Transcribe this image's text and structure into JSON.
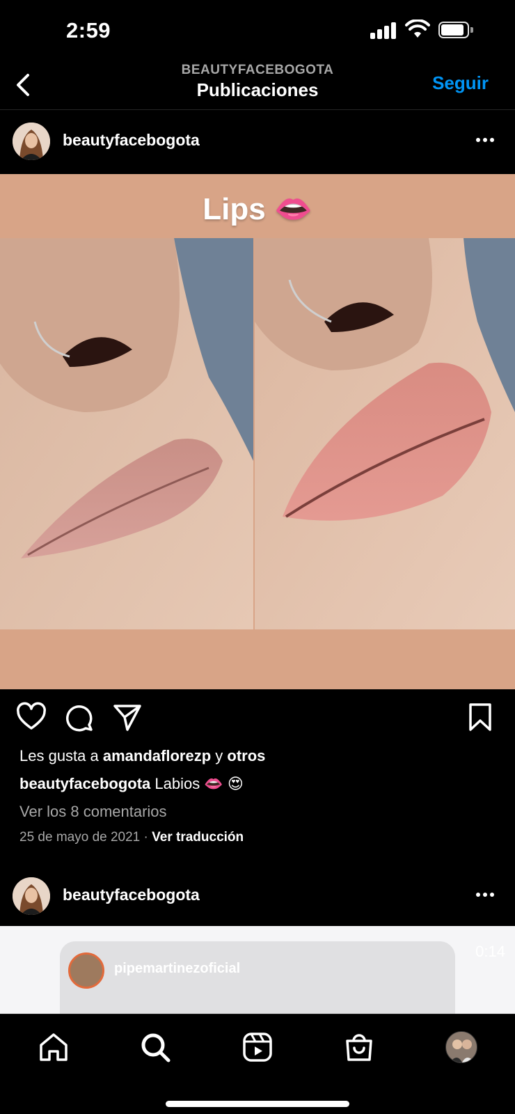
{
  "status_bar": {
    "time": "2:59"
  },
  "nav": {
    "account": "BEAUTYFACEBOGOTA",
    "title": "Publicaciones",
    "follow_label": "Seguir"
  },
  "post": {
    "username": "beautyfacebogota",
    "image_title": "Lips 👄",
    "likes_prefix": "Les gusta a ",
    "likes_user": "amandaflorezp",
    "likes_conj": " y ",
    "likes_others": "otros",
    "caption_user": "beautyfacebogota",
    "caption_text": " Labios 👄 😍",
    "comments_link": "Ver los 8 comentarios",
    "date": "25 de mayo de 2021",
    "date_sep": " · ",
    "translate_link": "Ver traducción"
  },
  "post2": {
    "username": "beautyfacebogota",
    "story_user": "pipemartinezoficial",
    "story_time": "0:14"
  },
  "icons": {
    "back": "chevron-left-icon",
    "more": "more-horizontal-icon",
    "like": "heart-icon",
    "comment": "comment-icon",
    "share": "send-icon",
    "save": "bookmark-icon",
    "home": "home-icon",
    "search": "search-icon",
    "reels": "reels-icon",
    "shop": "shop-bag-icon",
    "profile": "profile-avatar-icon"
  },
  "colors": {
    "background": "#000000",
    "accent": "#0095f6",
    "muted_text": "#a8a8a8",
    "post_bg": "#d8a487"
  }
}
